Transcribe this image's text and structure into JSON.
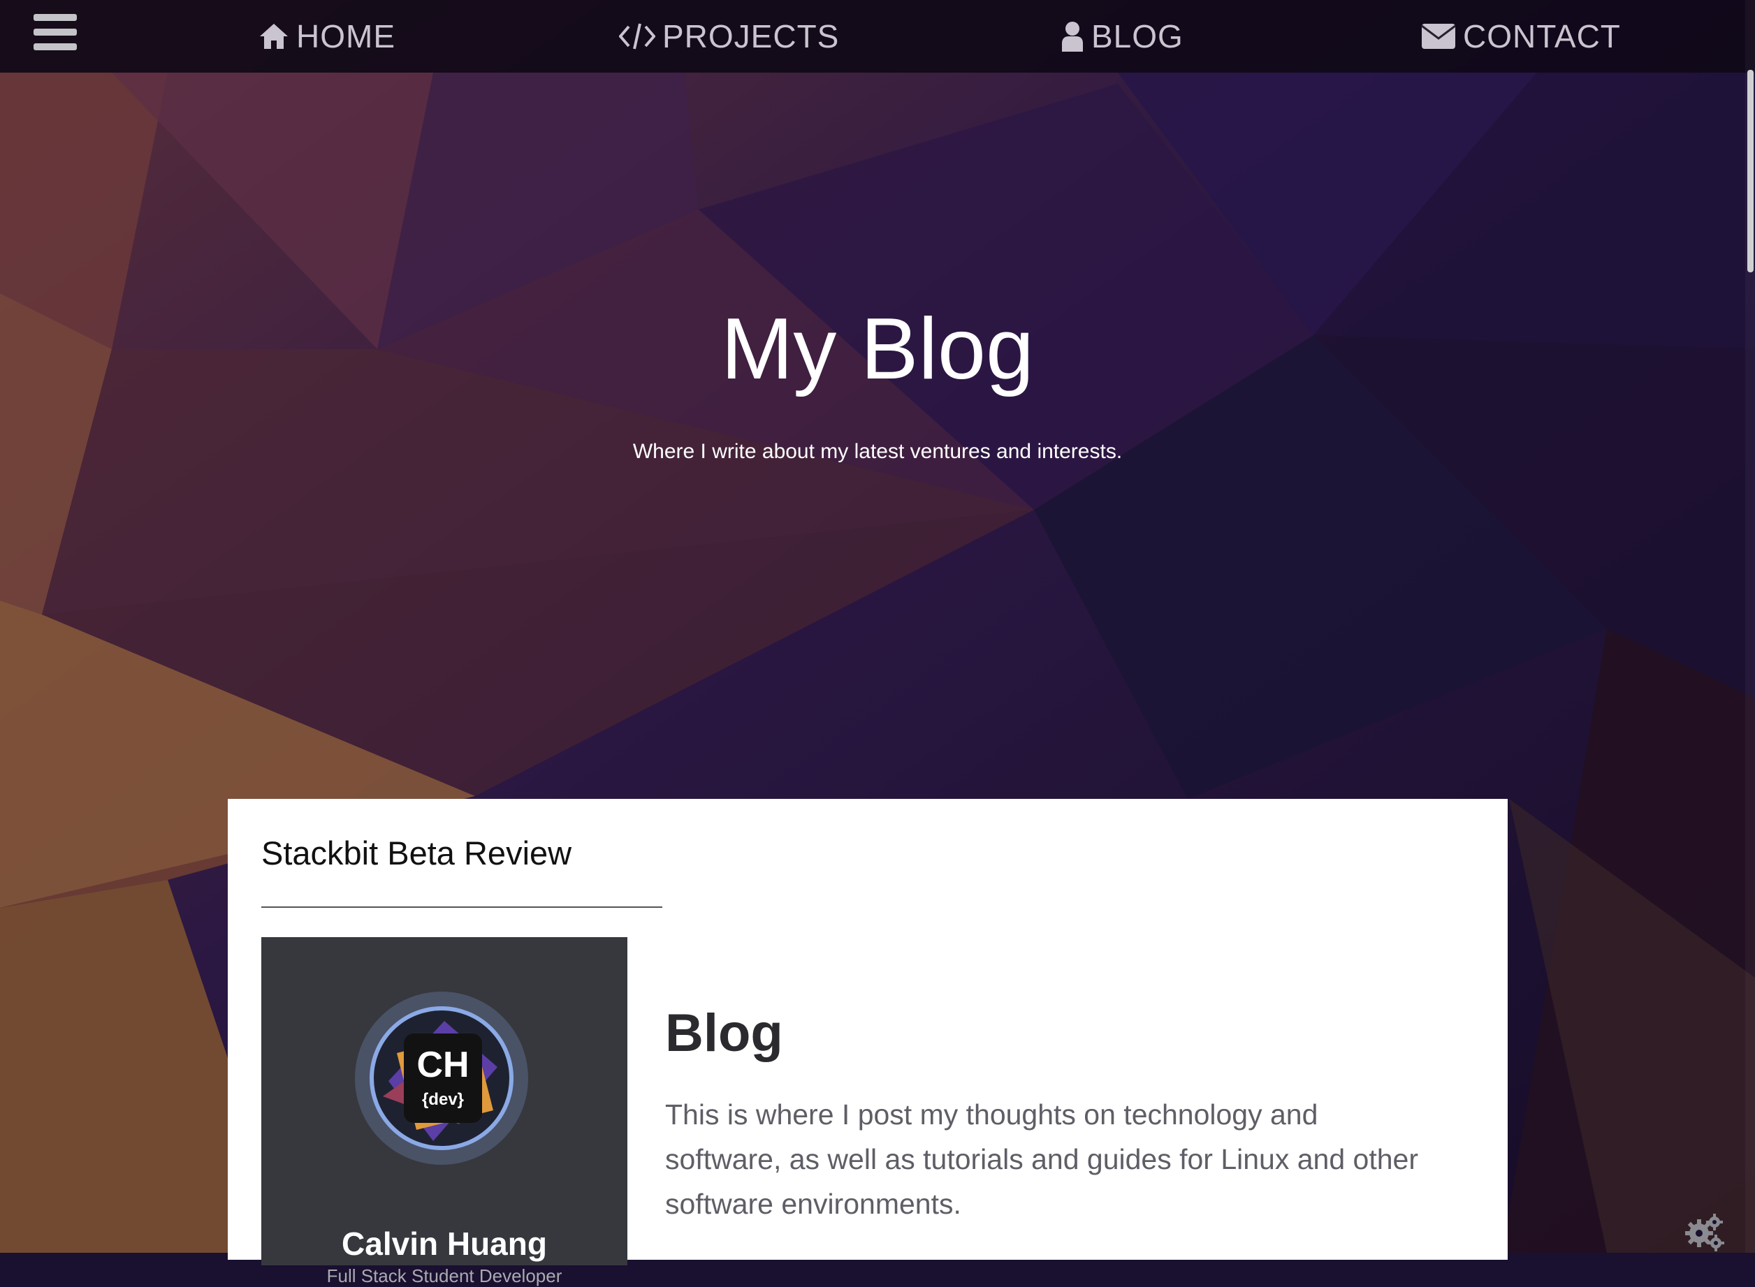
{
  "nav": {
    "items": [
      {
        "label": "HOME",
        "icon": "home-icon"
      },
      {
        "label": "PROJECTS",
        "icon": "code-icon"
      },
      {
        "label": "BLOG",
        "icon": "user-icon"
      },
      {
        "label": "CONTACT",
        "icon": "envelope-icon"
      }
    ]
  },
  "hero": {
    "title": "My Blog",
    "subtitle": "Where I write about my latest ventures and interests."
  },
  "post": {
    "title": "Stackbit Beta Review",
    "profile": {
      "logo_initials": "CH",
      "logo_tag": "{dev}",
      "name": "Calvin Huang",
      "role": "Full Stack Student Developer"
    },
    "heading": "Blog",
    "description": "This is where I post my thoughts on technology and software, as well as tutorials and guides for Linux and other software environments."
  },
  "colors": {
    "navbar": "#0e0816",
    "card": "#ffffff",
    "profile_panel": "#36383d",
    "logo_ring": "#8aa9e6",
    "logo_orange": "#e09a3c",
    "logo_purple": "#5b3ea6"
  }
}
